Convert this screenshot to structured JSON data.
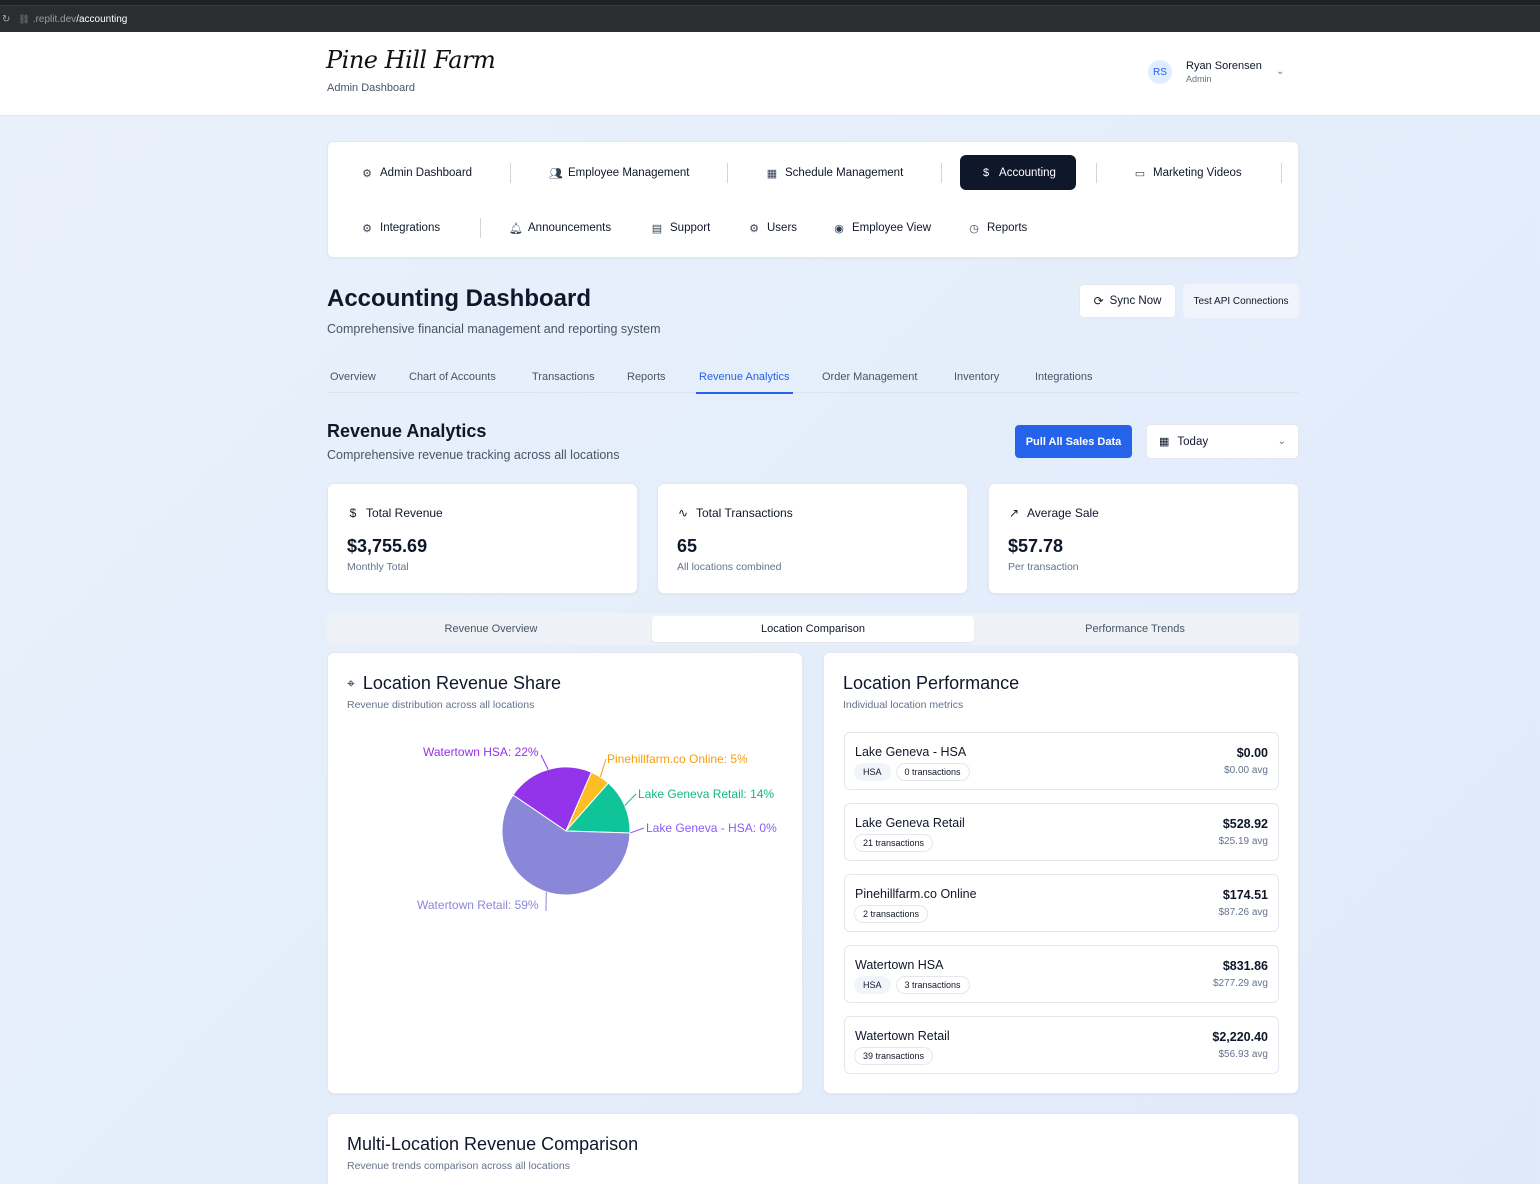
{
  "browser": {
    "url_host": ".replit.dev",
    "url_path": "/accounting"
  },
  "header": {
    "logo": "Pine Hill Farm",
    "subtitle": "Admin Dashboard",
    "user": {
      "initials": "RS",
      "name": "Ryan Sorensen",
      "role": "Admin"
    }
  },
  "nav": {
    "items": [
      {
        "label": "Admin Dashboard",
        "icon": "gear-icon"
      },
      {
        "label": "Employee Management",
        "icon": "users-icon"
      },
      {
        "label": "Schedule Management",
        "icon": "calendar-icon"
      },
      {
        "label": "Accounting",
        "icon": "dollar-icon",
        "active": true
      },
      {
        "label": "Marketing Videos",
        "icon": "video-icon"
      },
      {
        "label": "Integrations",
        "icon": "gear-icon"
      },
      {
        "label": "Announcements",
        "icon": "bell-icon"
      },
      {
        "label": "Support",
        "icon": "document-icon"
      },
      {
        "label": "Users",
        "icon": "gear-icon"
      },
      {
        "label": "Employee View",
        "icon": "eye-icon"
      },
      {
        "label": "Reports",
        "icon": "clock-icon"
      }
    ]
  },
  "page": {
    "title": "Accounting Dashboard",
    "subtitle": "Comprehensive financial management and reporting system",
    "sync_label": "Sync Now",
    "test_api_label": "Test API Connections"
  },
  "subtabs": [
    "Overview",
    "Chart of Accounts",
    "Transactions",
    "Reports",
    "Revenue Analytics",
    "Order Management",
    "Inventory",
    "Integrations"
  ],
  "subtabs_active": "Revenue Analytics",
  "revenue": {
    "title": "Revenue Analytics",
    "subtitle": "Comprehensive revenue tracking across all locations",
    "pull_label": "Pull All Sales Data",
    "period": "Today"
  },
  "stats": [
    {
      "label": "Total Revenue",
      "icon": "dollar-icon",
      "value": "$3,755.69",
      "note": "Monthly Total"
    },
    {
      "label": "Total Transactions",
      "icon": "activity-icon",
      "value": "65",
      "note": "All locations combined"
    },
    {
      "label": "Average Sale",
      "icon": "trending-up-icon",
      "value": "$57.78",
      "note": "Per transaction"
    }
  ],
  "view_tabs": [
    "Revenue Overview",
    "Location Comparison",
    "Performance Trends"
  ],
  "view_tabs_active": "Location Comparison",
  "share_panel": {
    "title": "Location Revenue Share",
    "subtitle": "Revenue distribution across all locations"
  },
  "chart_data": {
    "type": "pie",
    "title": "Location Revenue Share",
    "slices": [
      {
        "label": "Watertown HSA: 22%",
        "name": "Watertown HSA",
        "value": 22,
        "color": "#9333ea",
        "label_color": "#9333ea"
      },
      {
        "label": "Pinehillfarm.co Online: 5%",
        "name": "Pinehillfarm.co Online",
        "value": 5,
        "color": "#fbbf24",
        "label_color": "#f59e0b"
      },
      {
        "label": "Lake Geneva Retail: 14%",
        "name": "Lake Geneva Retail",
        "value": 14,
        "color": "#10c49a",
        "label_color": "#10b981"
      },
      {
        "label": "Lake Geneva - HSA: 0%",
        "name": "Lake Geneva - HSA",
        "value": 0,
        "color": "#8b5cf6",
        "label_color": "#8b5cf6"
      },
      {
        "label": "Watertown Retail: 59%",
        "name": "Watertown Retail",
        "value": 59,
        "color": "#8b87d8",
        "label_color": "#8b87d8"
      }
    ]
  },
  "performance_panel": {
    "title": "Location Performance",
    "subtitle": "Individual location metrics",
    "locations": [
      {
        "name": "Lake Geneva - HSA",
        "badges": [
          "HSA",
          "0 transactions"
        ],
        "amount": "$0.00",
        "avg": "$0.00 avg"
      },
      {
        "name": "Lake Geneva Retail",
        "badges": [
          "21 transactions"
        ],
        "amount": "$528.92",
        "avg": "$25.19 avg"
      },
      {
        "name": "Pinehillfarm.co Online",
        "badges": [
          "2 transactions"
        ],
        "amount": "$174.51",
        "avg": "$87.26 avg"
      },
      {
        "name": "Watertown HSA",
        "badges": [
          "HSA",
          "3 transactions"
        ],
        "amount": "$831.86",
        "avg": "$277.29 avg"
      },
      {
        "name": "Watertown Retail",
        "badges": [
          "39 transactions"
        ],
        "amount": "$2,220.40",
        "avg": "$56.93 avg"
      }
    ]
  },
  "comparison_panel": {
    "title": "Multi-Location Revenue Comparison",
    "subtitle": "Revenue trends comparison across all locations"
  }
}
